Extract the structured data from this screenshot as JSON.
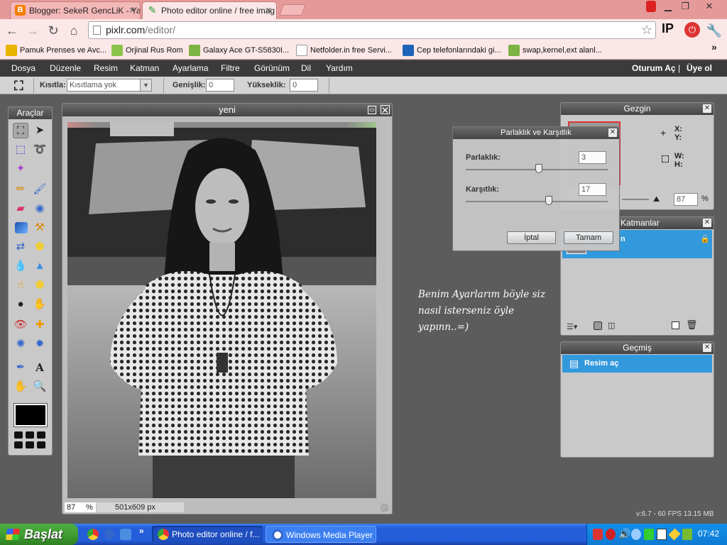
{
  "browser": {
    "tabs": [
      {
        "title": "Blogger: SekeR GencLiK - Yay",
        "icon": "blogger-icon"
      },
      {
        "title": "Photo editor online / free imag",
        "icon": "pixlr-brush-icon"
      }
    ],
    "url_host": "pixlr.com",
    "url_path": "/editor/",
    "ip_badge": "IP",
    "bookmarks": [
      {
        "label": "Pamuk Prenses ve Avc...",
        "icon": "hd-film-icon"
      },
      {
        "label": "Orjinal Rus Rom",
        "icon": "android-icon"
      },
      {
        "label": "Galaxy Ace GT-S5830I...",
        "icon": "android-icon"
      },
      {
        "label": "Netfolder.in free Servi...",
        "icon": "page-icon"
      },
      {
        "label": "Cep telefonlarındaki gi...",
        "icon": "forum-icon"
      },
      {
        "label": "swap,kernel,ext alanl...",
        "icon": "android-icon"
      }
    ],
    "more": "»"
  },
  "menubar": {
    "items": [
      "Dosya",
      "Düzenle",
      "Resim",
      "Katman",
      "Ayarlama",
      "Filtre",
      "Görünüm",
      "Dil",
      "Yardım"
    ],
    "login": "Oturum Aç",
    "separator": "|",
    "signup": "Üye ol"
  },
  "options": {
    "constrain_label": "Kısıtla:",
    "constrain_value": "Kısıtlama yok",
    "width_label": "Genişlik:",
    "width_value": "0",
    "height_label": "Yükseklik:",
    "height_value": "0"
  },
  "tools_panel": {
    "title": "Araçlar"
  },
  "canvas_window": {
    "title": "yeni",
    "zoom_value": "87",
    "zoom_unit": "%",
    "dimensions": "501x609 px"
  },
  "navigator": {
    "title": "Gezgin",
    "x_label": "X:",
    "y_label": "Y:",
    "w_label": "W:",
    "h_label": "H:",
    "zoom": "87",
    "zoom_unit": "%"
  },
  "layers": {
    "title": "Katmanlar",
    "layer_name": "n"
  },
  "history": {
    "title": "Geçmiş",
    "items": [
      "Resim aç"
    ]
  },
  "dialog": {
    "title": "Parlaklık ve Karşıtlık",
    "brightness_label": "Parlaklık:",
    "brightness_value": "3",
    "contrast_label": "Karşıtlık:",
    "contrast_value": "17",
    "cancel": "İptal",
    "ok": "Tamam"
  },
  "overlay_text": [
    "Benim Ayarlarım böyle siz",
    "nasıl isterseniz öyle",
    "yapınn..=)"
  ],
  "version": "v:6.7 - 60 FPS 13.15 MB",
  "taskbar": {
    "start": "Başlat",
    "tasks": [
      {
        "label": "Photo editor online / f...",
        "icon": "chrome-icon"
      },
      {
        "label": "Windows Media Player",
        "icon": "media-player-icon"
      }
    ],
    "quicklaunch_more": "»",
    "clock": "07:42"
  },
  "colors": {
    "tabstrip": "#e59a9a",
    "menubar": "#3b3b3b",
    "workspace": "#5c5c5c",
    "selection_blue": "#3399dd",
    "taskbar_blue": "#245edb",
    "start_green": "#3c9a2e"
  }
}
